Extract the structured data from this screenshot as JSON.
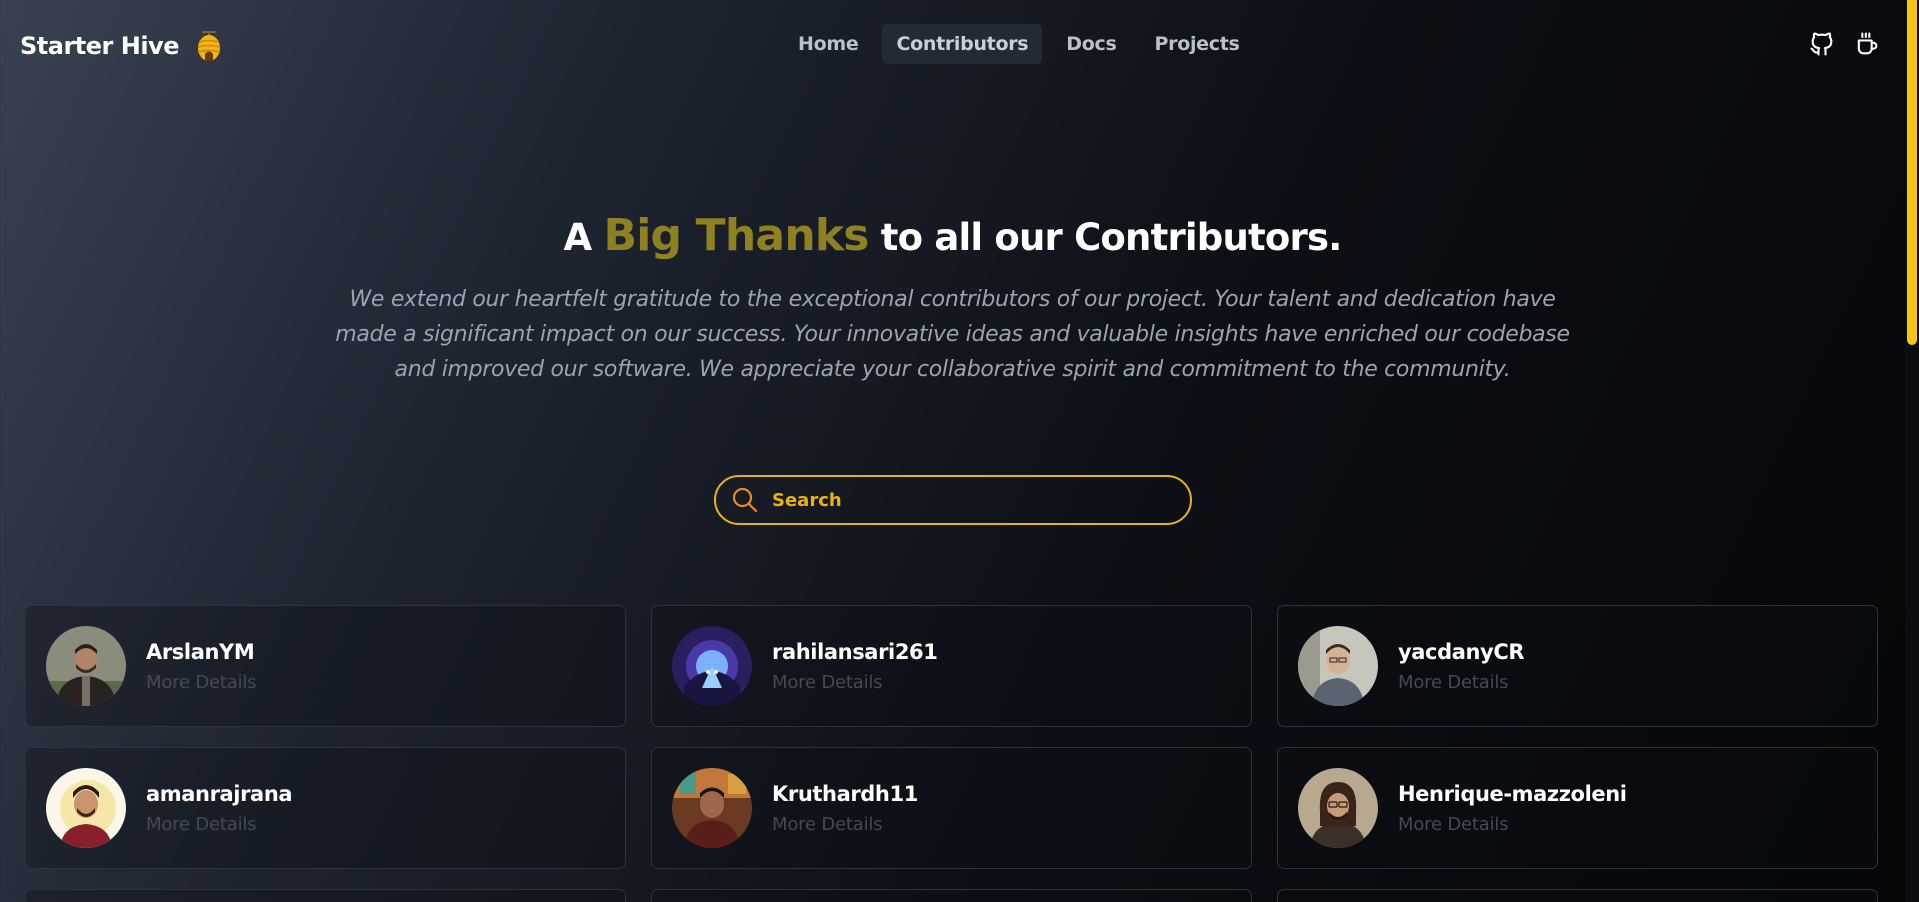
{
  "nav": {
    "brand": "Starter Hive",
    "brand_icon": "beehive-icon",
    "links": [
      {
        "label": "Home",
        "active": false
      },
      {
        "label": "Contributors",
        "active": true
      },
      {
        "label": "Docs",
        "active": false
      },
      {
        "label": "Projects",
        "active": false
      }
    ],
    "icons": [
      "github-icon",
      "coffee-cup-icon"
    ]
  },
  "hero": {
    "title_prefix": "A ",
    "title_accent": "Big Thanks",
    "title_suffix": " to all our Contributors.",
    "description": "We extend our heartfelt gratitude to the exceptional contributors of our project. Your talent and dedication have made a significant impact on our success. Your innovative ideas and valuable insights have enriched our codebase and improved our software. We appreciate your collaborative spirit and commitment to the community."
  },
  "search": {
    "placeholder": "Search",
    "value": "",
    "icon": "search-icon"
  },
  "contributors": [
    {
      "name": "ArslanYM",
      "link_label": "More Details"
    },
    {
      "name": "rahilansari261",
      "link_label": "More Details"
    },
    {
      "name": "yacdanyCR",
      "link_label": "More Details"
    },
    {
      "name": "amanrajrana",
      "link_label": "More Details"
    },
    {
      "name": "Kruthardh11",
      "link_label": "More Details"
    },
    {
      "name": "Henrique-mazzoleni",
      "link_label": "More Details"
    }
  ],
  "colors": {
    "accent": "#eab30f",
    "title_accent": "#8f8022",
    "scrollbar_thumb": "#f5c518"
  }
}
